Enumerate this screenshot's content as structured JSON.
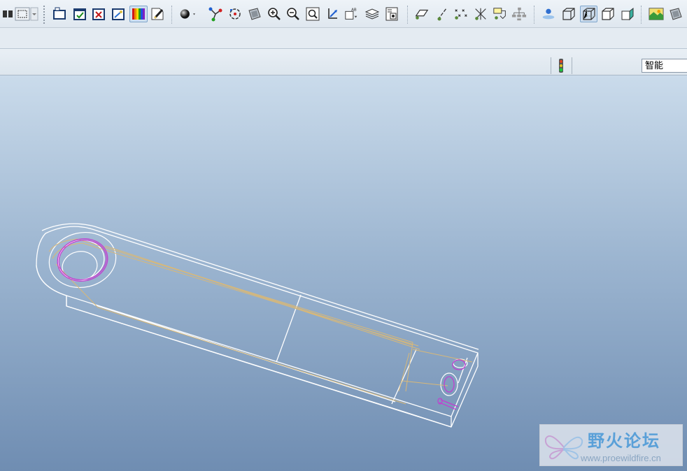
{
  "toolbar": {
    "buttons": [
      {
        "icon": "copy-icon"
      },
      {
        "icon": "select-box-icon"
      },
      {
        "icon": "window-activate-icon"
      },
      {
        "icon": "window-check-icon"
      },
      {
        "icon": "window-close-icon"
      },
      {
        "icon": "edit-window-icon"
      },
      {
        "icon": "color-bars-icon"
      },
      {
        "icon": "appearance-pen-icon"
      },
      {
        "icon": "sphere-display-icon"
      },
      {
        "icon": "spin-center-icon"
      },
      {
        "icon": "orient-mode-icon"
      },
      {
        "icon": "shaded-view-icon"
      },
      {
        "icon": "zoom-in-icon"
      },
      {
        "icon": "zoom-out-icon"
      },
      {
        "icon": "refit-icon"
      },
      {
        "icon": "reorient-icon"
      },
      {
        "icon": "saved-views-icon"
      },
      {
        "icon": "layers-icon"
      },
      {
        "icon": "view-manager-icon"
      },
      {
        "icon": "plane-display-icon"
      },
      {
        "icon": "axis-display-icon"
      },
      {
        "icon": "point-display-icon"
      },
      {
        "icon": "csys-display-icon"
      },
      {
        "icon": "annotation-display-icon"
      },
      {
        "icon": "model-tree-icon"
      },
      {
        "icon": "spin-center-display-icon"
      },
      {
        "icon": "wireframe-icon"
      },
      {
        "icon": "hidden-line-icon"
      },
      {
        "icon": "no-hidden-icon"
      },
      {
        "icon": "shading-icon"
      },
      {
        "icon": "render-icon"
      },
      {
        "icon": "perspective-icon"
      }
    ],
    "active_button": "hidden-line-icon"
  },
  "statusbar": {
    "filter_value": "智能",
    "regen_status_icon": "traffic-light-icon"
  },
  "viewport": {
    "background_top": "#cadbeb",
    "background_bottom": "#6f8db2",
    "model_edge_color": "#ffffff",
    "tangent_edge_color": "#d8b878",
    "hole_edge_color": "#c040d0"
  },
  "watermark": {
    "title": "野火论坛",
    "url": "www.proewildfire.cn"
  }
}
